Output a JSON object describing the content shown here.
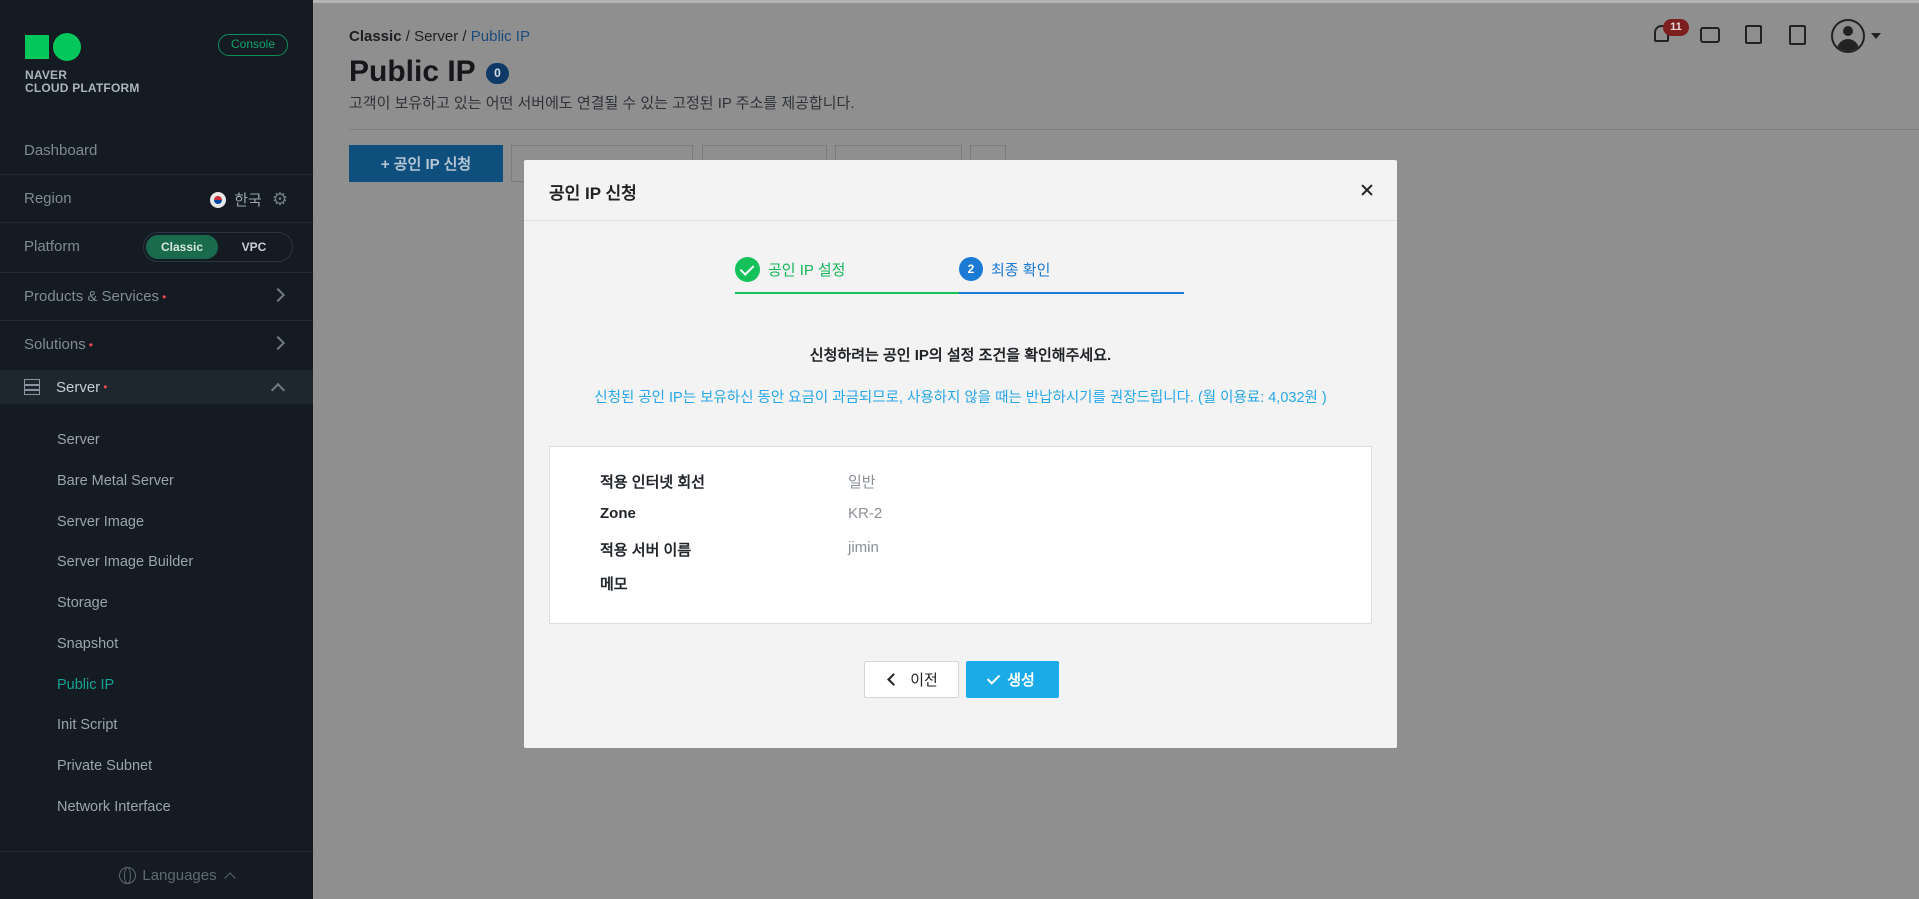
{
  "sidebar": {
    "logo_line1": "NAVER",
    "logo_line2": "CLOUD PLATFORM",
    "console_badge": "Console",
    "dashboard": "Dashboard",
    "region_label": "Region",
    "region_value": "한국",
    "platform_label": "Platform",
    "platform_options": [
      "Classic",
      "VPC"
    ],
    "platform_selected": "Classic",
    "products_services": "Products & Services",
    "solutions": "Solutions",
    "server_section": "Server",
    "server_items": [
      {
        "label": "Server",
        "active": false
      },
      {
        "label": "Bare Metal Server",
        "active": false
      },
      {
        "label": "Server Image",
        "active": false
      },
      {
        "label": "Server Image Builder",
        "active": false
      },
      {
        "label": "Storage",
        "active": false
      },
      {
        "label": "Snapshot",
        "active": false
      },
      {
        "label": "Public IP",
        "active": true
      },
      {
        "label": "Init Script",
        "active": false
      },
      {
        "label": "Private Subnet",
        "active": false
      },
      {
        "label": "Network Interface",
        "active": false
      }
    ],
    "languages": "Languages"
  },
  "header": {
    "breadcrumb": [
      "Classic",
      "Server",
      "Public IP"
    ],
    "title": "Public IP",
    "count": "0",
    "description": "고객이 보유하고 있는 어떤 서버에도 연결될 수 있는 고정된 IP 주소를 제공합니다.",
    "notification_count": "11",
    "primary_button": "+ 공인 IP 신청"
  },
  "modal": {
    "title": "공인 IP 신청",
    "steps": [
      {
        "number": "1",
        "label": "공인 IP 설정",
        "status": "done"
      },
      {
        "number": "2",
        "label": "최종 확인",
        "status": "current"
      }
    ],
    "confirm_message": "신청하려는 공인 IP의 설정 조건을 확인해주세요.",
    "notice_message": "신청된 공인 IP는 보유하신 동안 요금이 과금되므로, 사용하지 않을 때는 반납하시기를 권장드립니다. (월 이용료: 4,032원 )",
    "details": [
      {
        "label": "적용 인터넷 회선",
        "value": "일반"
      },
      {
        "label": "Zone",
        "value": "KR-2"
      },
      {
        "label": "적용 서버 이름",
        "value": "jimin"
      },
      {
        "label": "메모",
        "value": ""
      }
    ],
    "prev_button": "이전",
    "create_button": "생성"
  },
  "colors": {
    "sidebar_bg": "#141b22",
    "accent_green": "#14c15a",
    "accent_blue": "#1a7ad4",
    "create_button": "#1aabe8",
    "active_menu": "#16a394"
  }
}
